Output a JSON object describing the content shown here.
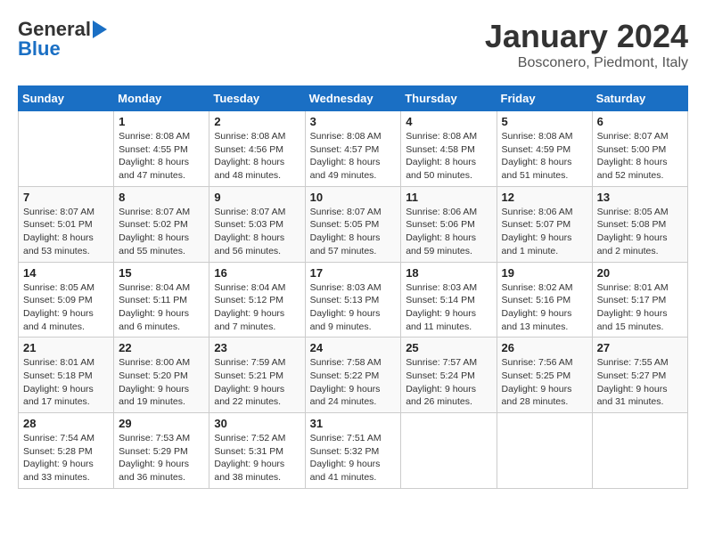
{
  "logo": {
    "part1": "General",
    "part2": "Blue"
  },
  "title": "January 2024",
  "location": "Bosconero, Piedmont, Italy",
  "days_of_week": [
    "Sunday",
    "Monday",
    "Tuesday",
    "Wednesday",
    "Thursday",
    "Friday",
    "Saturday"
  ],
  "weeks": [
    [
      {
        "day": "",
        "sunrise": "",
        "sunset": "",
        "daylight": ""
      },
      {
        "day": "1",
        "sunrise": "Sunrise: 8:08 AM",
        "sunset": "Sunset: 4:55 PM",
        "daylight": "Daylight: 8 hours and 47 minutes."
      },
      {
        "day": "2",
        "sunrise": "Sunrise: 8:08 AM",
        "sunset": "Sunset: 4:56 PM",
        "daylight": "Daylight: 8 hours and 48 minutes."
      },
      {
        "day": "3",
        "sunrise": "Sunrise: 8:08 AM",
        "sunset": "Sunset: 4:57 PM",
        "daylight": "Daylight: 8 hours and 49 minutes."
      },
      {
        "day": "4",
        "sunrise": "Sunrise: 8:08 AM",
        "sunset": "Sunset: 4:58 PM",
        "daylight": "Daylight: 8 hours and 50 minutes."
      },
      {
        "day": "5",
        "sunrise": "Sunrise: 8:08 AM",
        "sunset": "Sunset: 4:59 PM",
        "daylight": "Daylight: 8 hours and 51 minutes."
      },
      {
        "day": "6",
        "sunrise": "Sunrise: 8:07 AM",
        "sunset": "Sunset: 5:00 PM",
        "daylight": "Daylight: 8 hours and 52 minutes."
      }
    ],
    [
      {
        "day": "7",
        "sunrise": "Sunrise: 8:07 AM",
        "sunset": "Sunset: 5:01 PM",
        "daylight": "Daylight: 8 hours and 53 minutes."
      },
      {
        "day": "8",
        "sunrise": "Sunrise: 8:07 AM",
        "sunset": "Sunset: 5:02 PM",
        "daylight": "Daylight: 8 hours and 55 minutes."
      },
      {
        "day": "9",
        "sunrise": "Sunrise: 8:07 AM",
        "sunset": "Sunset: 5:03 PM",
        "daylight": "Daylight: 8 hours and 56 minutes."
      },
      {
        "day": "10",
        "sunrise": "Sunrise: 8:07 AM",
        "sunset": "Sunset: 5:05 PM",
        "daylight": "Daylight: 8 hours and 57 minutes."
      },
      {
        "day": "11",
        "sunrise": "Sunrise: 8:06 AM",
        "sunset": "Sunset: 5:06 PM",
        "daylight": "Daylight: 8 hours and 59 minutes."
      },
      {
        "day": "12",
        "sunrise": "Sunrise: 8:06 AM",
        "sunset": "Sunset: 5:07 PM",
        "daylight": "Daylight: 9 hours and 1 minute."
      },
      {
        "day": "13",
        "sunrise": "Sunrise: 8:05 AM",
        "sunset": "Sunset: 5:08 PM",
        "daylight": "Daylight: 9 hours and 2 minutes."
      }
    ],
    [
      {
        "day": "14",
        "sunrise": "Sunrise: 8:05 AM",
        "sunset": "Sunset: 5:09 PM",
        "daylight": "Daylight: 9 hours and 4 minutes."
      },
      {
        "day": "15",
        "sunrise": "Sunrise: 8:04 AM",
        "sunset": "Sunset: 5:11 PM",
        "daylight": "Daylight: 9 hours and 6 minutes."
      },
      {
        "day": "16",
        "sunrise": "Sunrise: 8:04 AM",
        "sunset": "Sunset: 5:12 PM",
        "daylight": "Daylight: 9 hours and 7 minutes."
      },
      {
        "day": "17",
        "sunrise": "Sunrise: 8:03 AM",
        "sunset": "Sunset: 5:13 PM",
        "daylight": "Daylight: 9 hours and 9 minutes."
      },
      {
        "day": "18",
        "sunrise": "Sunrise: 8:03 AM",
        "sunset": "Sunset: 5:14 PM",
        "daylight": "Daylight: 9 hours and 11 minutes."
      },
      {
        "day": "19",
        "sunrise": "Sunrise: 8:02 AM",
        "sunset": "Sunset: 5:16 PM",
        "daylight": "Daylight: 9 hours and 13 minutes."
      },
      {
        "day": "20",
        "sunrise": "Sunrise: 8:01 AM",
        "sunset": "Sunset: 5:17 PM",
        "daylight": "Daylight: 9 hours and 15 minutes."
      }
    ],
    [
      {
        "day": "21",
        "sunrise": "Sunrise: 8:01 AM",
        "sunset": "Sunset: 5:18 PM",
        "daylight": "Daylight: 9 hours and 17 minutes."
      },
      {
        "day": "22",
        "sunrise": "Sunrise: 8:00 AM",
        "sunset": "Sunset: 5:20 PM",
        "daylight": "Daylight: 9 hours and 19 minutes."
      },
      {
        "day": "23",
        "sunrise": "Sunrise: 7:59 AM",
        "sunset": "Sunset: 5:21 PM",
        "daylight": "Daylight: 9 hours and 22 minutes."
      },
      {
        "day": "24",
        "sunrise": "Sunrise: 7:58 AM",
        "sunset": "Sunset: 5:22 PM",
        "daylight": "Daylight: 9 hours and 24 minutes."
      },
      {
        "day": "25",
        "sunrise": "Sunrise: 7:57 AM",
        "sunset": "Sunset: 5:24 PM",
        "daylight": "Daylight: 9 hours and 26 minutes."
      },
      {
        "day": "26",
        "sunrise": "Sunrise: 7:56 AM",
        "sunset": "Sunset: 5:25 PM",
        "daylight": "Daylight: 9 hours and 28 minutes."
      },
      {
        "day": "27",
        "sunrise": "Sunrise: 7:55 AM",
        "sunset": "Sunset: 5:27 PM",
        "daylight": "Daylight: 9 hours and 31 minutes."
      }
    ],
    [
      {
        "day": "28",
        "sunrise": "Sunrise: 7:54 AM",
        "sunset": "Sunset: 5:28 PM",
        "daylight": "Daylight: 9 hours and 33 minutes."
      },
      {
        "day": "29",
        "sunrise": "Sunrise: 7:53 AM",
        "sunset": "Sunset: 5:29 PM",
        "daylight": "Daylight: 9 hours and 36 minutes."
      },
      {
        "day": "30",
        "sunrise": "Sunrise: 7:52 AM",
        "sunset": "Sunset: 5:31 PM",
        "daylight": "Daylight: 9 hours and 38 minutes."
      },
      {
        "day": "31",
        "sunrise": "Sunrise: 7:51 AM",
        "sunset": "Sunset: 5:32 PM",
        "daylight": "Daylight: 9 hours and 41 minutes."
      },
      {
        "day": "",
        "sunrise": "",
        "sunset": "",
        "daylight": ""
      },
      {
        "day": "",
        "sunrise": "",
        "sunset": "",
        "daylight": ""
      },
      {
        "day": "",
        "sunrise": "",
        "sunset": "",
        "daylight": ""
      }
    ]
  ]
}
